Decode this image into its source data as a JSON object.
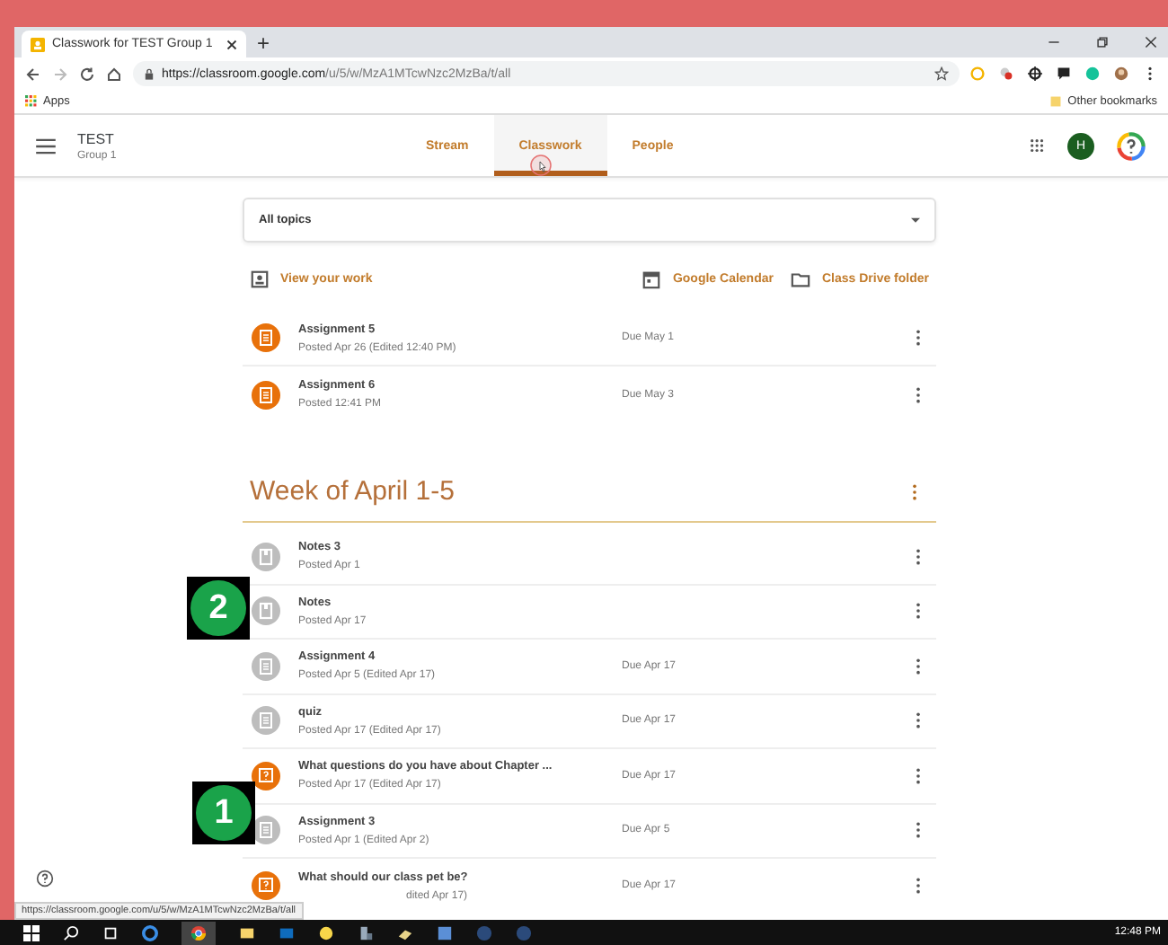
{
  "browser": {
    "tab_title": "Classwork for TEST Group 1",
    "new_tab": "+",
    "url_host": "https://classroom.google.com",
    "url_path": "/u/5/w/MzA1MTcwNzc2MzBa/t/all",
    "bookmarks": [
      {
        "label": "Apps",
        "kind": "apps"
      },
      {
        "label": "Other bookmarks",
        "kind": "folder"
      }
    ]
  },
  "header": {
    "class_name": "TEST",
    "section": "Group 1",
    "avatar": "H",
    "tabs": [
      {
        "label": "Stream",
        "selected": false
      },
      {
        "label": "Classwork",
        "selected": true
      },
      {
        "label": "People",
        "selected": false
      }
    ]
  },
  "filter": {
    "value": "All topics"
  },
  "links": [
    {
      "label": "View your work",
      "kind": "work"
    },
    {
      "label": "Google Calendar",
      "kind": "calendar"
    },
    {
      "label": "Class Drive folder",
      "kind": "folder"
    }
  ],
  "items": [
    {
      "title": "Assignment 5",
      "posted": "Posted Apr 26 (Edited 12:40 PM)",
      "due": "Due May 1",
      "kind": "assignment",
      "color": "#e8710a"
    },
    {
      "title": "Assignment 6",
      "posted": "Posted 12:41 PM",
      "due": "Due May 3",
      "kind": "assignment",
      "color": "#e8710a"
    }
  ],
  "topic": {
    "title": "Week of April 1-5",
    "items": [
      {
        "title": "Notes 3",
        "posted": "Posted Apr 1",
        "kind": "material",
        "color": "#bdbdbd"
      },
      {
        "title": "Notes",
        "posted": "Posted Apr 17",
        "kind": "material",
        "color": "#bdbdbd"
      },
      {
        "title": "Assignment 4",
        "posted": "Posted Apr 5 (Edited Apr 17)",
        "due": "Due Apr 17",
        "kind": "assignment",
        "color": "#bdbdbd"
      },
      {
        "title": "quiz",
        "posted": "Posted Apr 17 (Edited Apr 17)",
        "due": "Due Apr 17",
        "kind": "assignment",
        "color": "#bdbdbd"
      },
      {
        "title": "What questions do you have about Chapter ...",
        "posted": "Posted Apr 17 (Edited Apr 17)",
        "due": "Due Apr 17",
        "kind": "question",
        "color": "#e8710a"
      },
      {
        "title": "Assignment 3",
        "posted": "Posted Apr 1 (Edited Apr 2)",
        "due": "Due Apr 5",
        "kind": "assignment",
        "color": "#bdbdbd"
      },
      {
        "title": "What should our class pet be?",
        "posted": "dited Apr 17)",
        "due": "Due Apr 17",
        "kind": "question",
        "color": "#e8710a"
      }
    ]
  },
  "markers": [
    {
      "label": "2"
    },
    {
      "label": "1"
    }
  ],
  "status_url": "https://classroom.google.com/u/5/w/MzA1MTcwNzc2MzBa/t/all",
  "clock": "12:48 PM"
}
